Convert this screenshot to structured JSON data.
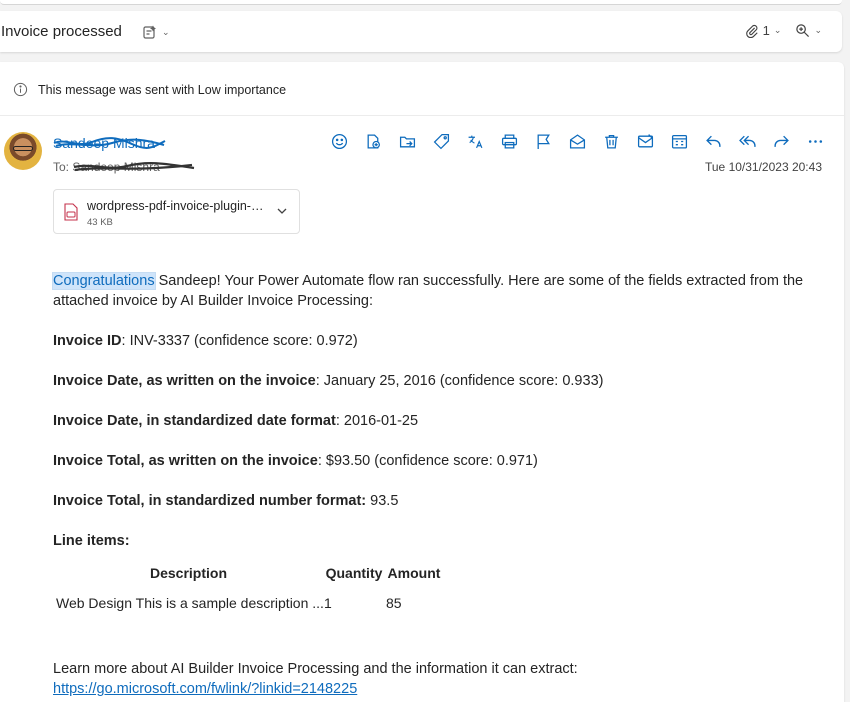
{
  "subject": {
    "title": "Invoice processed",
    "attachment_count": "1"
  },
  "importance": {
    "text": "This message was sent with Low importance"
  },
  "sender": {
    "name": "Sandeep Mishra",
    "to_label": "To:",
    "to_name": "Sandeep Mishra",
    "date": "Tue 10/31/2023 20:43"
  },
  "actions": [
    {
      "name": "emoji-icon"
    },
    {
      "name": "apps-icon"
    },
    {
      "name": "move-folder-icon"
    },
    {
      "name": "tag-icon"
    },
    {
      "name": "translate-icon"
    },
    {
      "name": "print-icon"
    },
    {
      "name": "flag-icon"
    },
    {
      "name": "mark-read-icon"
    },
    {
      "name": "delete-icon"
    },
    {
      "name": "report-icon"
    },
    {
      "name": "calendar-icon"
    },
    {
      "name": "reply-icon"
    },
    {
      "name": "reply-all-icon"
    },
    {
      "name": "forward-icon"
    },
    {
      "name": "more-icon"
    }
  ],
  "attachment": {
    "name": "wordpress-pdf-invoice-plugin-sample.pdf",
    "size": "43 KB"
  },
  "body": {
    "intro_highlight": "Congratulations",
    "intro_rest": " Sandeep! Your Power Automate flow ran successfully. Here are some of the fields extracted from the attached invoice by AI Builder Invoice Processing:",
    "fields": [
      {
        "label": "Invoice ID",
        "sep": ": ",
        "value": "INV-3337 (confidence score: 0.972)"
      },
      {
        "label": "Invoice Date, as written on the invoice",
        "sep": ": ",
        "value": "January 25, 2016 (confidence score: 0.933)"
      },
      {
        "label": "Invoice Date, in standardized date format",
        "sep": ": ",
        "value": "2016-01-25"
      },
      {
        "label": "Invoice Total, as written on the invoice",
        "sep": ": ",
        "value": "$93.50 (confidence score: 0.971)"
      },
      {
        "label": "Invoice Total, in standardized number format:",
        "sep": " ",
        "value": "93.5"
      }
    ],
    "line_items_label": "Line items:",
    "table": {
      "headers": [
        "Description",
        "Quantity",
        "Amount"
      ],
      "rows": [
        [
          "Web Design This is a sample description ...",
          "1",
          "85"
        ]
      ]
    },
    "learn_more": "Learn more about AI Builder Invoice Processing and the information it can extract:",
    "link": "https://go.microsoft.com/fwlink/?linkid=2148225"
  },
  "colors": {
    "accent": "#0f6cbd",
    "highlight": "#cfe4fa"
  }
}
